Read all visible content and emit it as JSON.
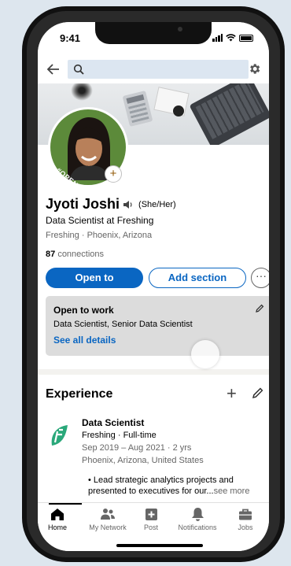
{
  "status": {
    "time": "9:41"
  },
  "search": {
    "placeholder": ""
  },
  "profile": {
    "open_to_work_badge": "#OPENTOWORK",
    "name": "Jyoti Joshi",
    "pronouns": "(She/Her)",
    "headline": "Data Scientist at Freshing",
    "location": "Freshing · Phoenix, Arizona",
    "connections_count": "87",
    "connections_label": "connections",
    "open_to_label": "Open to",
    "add_section_label": "Add section",
    "more_label": "···"
  },
  "open_to_work": {
    "title": "Open to work",
    "roles": "Data Scientist, Senior Data Scientist",
    "details_link": "See all details"
  },
  "experience": {
    "section_title": "Experience",
    "jobs": [
      {
        "title": "Data Scientist",
        "company": "Freshing · Full-time",
        "dates": "Sep 2019 – Aug 2021 · 2 yrs",
        "location": "Phoenix, Arizona, United States",
        "bullet": "Lead strategic analytics projects and presented to executives for our...",
        "see_more": "see more"
      }
    ]
  },
  "nav": {
    "home": "Home",
    "network": "My Network",
    "post": "Post",
    "notifications": "Notifications",
    "jobs": "Jobs"
  },
  "colors": {
    "brand_blue": "#0a66c2",
    "open_to_work_green": "#5c8a3a",
    "card_grey": "#dcdcdc"
  }
}
